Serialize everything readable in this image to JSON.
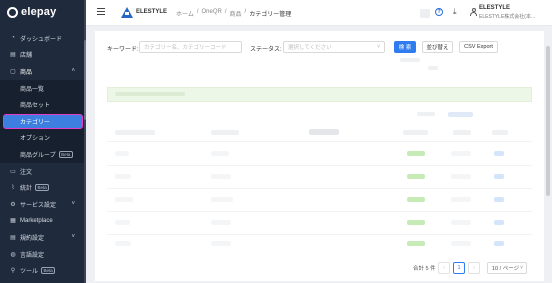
{
  "brand": {
    "name": "elepay"
  },
  "sidebar": {
    "items": [
      {
        "label": "ダッシュボード",
        "icon": "dashboard-icon"
      },
      {
        "label": "店舗",
        "icon": "store-icon"
      },
      {
        "label": "商品",
        "icon": "product-icon",
        "expanded": true
      },
      {
        "label": "商品一覧",
        "sub": true
      },
      {
        "label": "商品セット",
        "sub": true
      },
      {
        "label": "カテゴリー",
        "sub": true,
        "selected": true
      },
      {
        "label": "オプション",
        "sub": true
      },
      {
        "label": "商品グループ",
        "sub": true,
        "badge": "Beta"
      },
      {
        "label": "注文",
        "icon": "order-icon"
      },
      {
        "label": "統計",
        "icon": "stats-icon",
        "badge": "Beta"
      },
      {
        "label": "サービス設定",
        "icon": "service-icon"
      },
      {
        "label": "Marketplace",
        "icon": "marketplace-icon"
      },
      {
        "label": "規約設定",
        "icon": "terms-icon"
      },
      {
        "label": "言語設定",
        "icon": "language-icon"
      },
      {
        "label": "ツール",
        "icon": "tool-icon",
        "badge": "Beta"
      }
    ]
  },
  "header": {
    "org_name": "ELESTYLE",
    "breadcrumb": [
      "ホーム",
      "OneQR",
      "商品",
      "カテゴリー管理"
    ],
    "help_label": "?",
    "user_name": "ELESTYLE",
    "user_org": "ELESTYLE株式会社(本..."
  },
  "filters": {
    "keyword_label": "キーワード:",
    "keyword_placeholder": "カテゴリー名、カテゴリーコード",
    "status_label": "ステータス:",
    "status_placeholder": "選択してください",
    "search_button": "検 索",
    "sort_button": "並び替え",
    "export_button": "CSV Export"
  },
  "pagination": {
    "total_text": "合計 5 件",
    "prev": "‹",
    "current_page": "1",
    "next": "›",
    "page_size": "10 / ページ"
  },
  "colors": {
    "sidebar_bg": "#1f2a3c",
    "accent": "#2f7cf0",
    "selection_outline": "#e43bc8"
  }
}
